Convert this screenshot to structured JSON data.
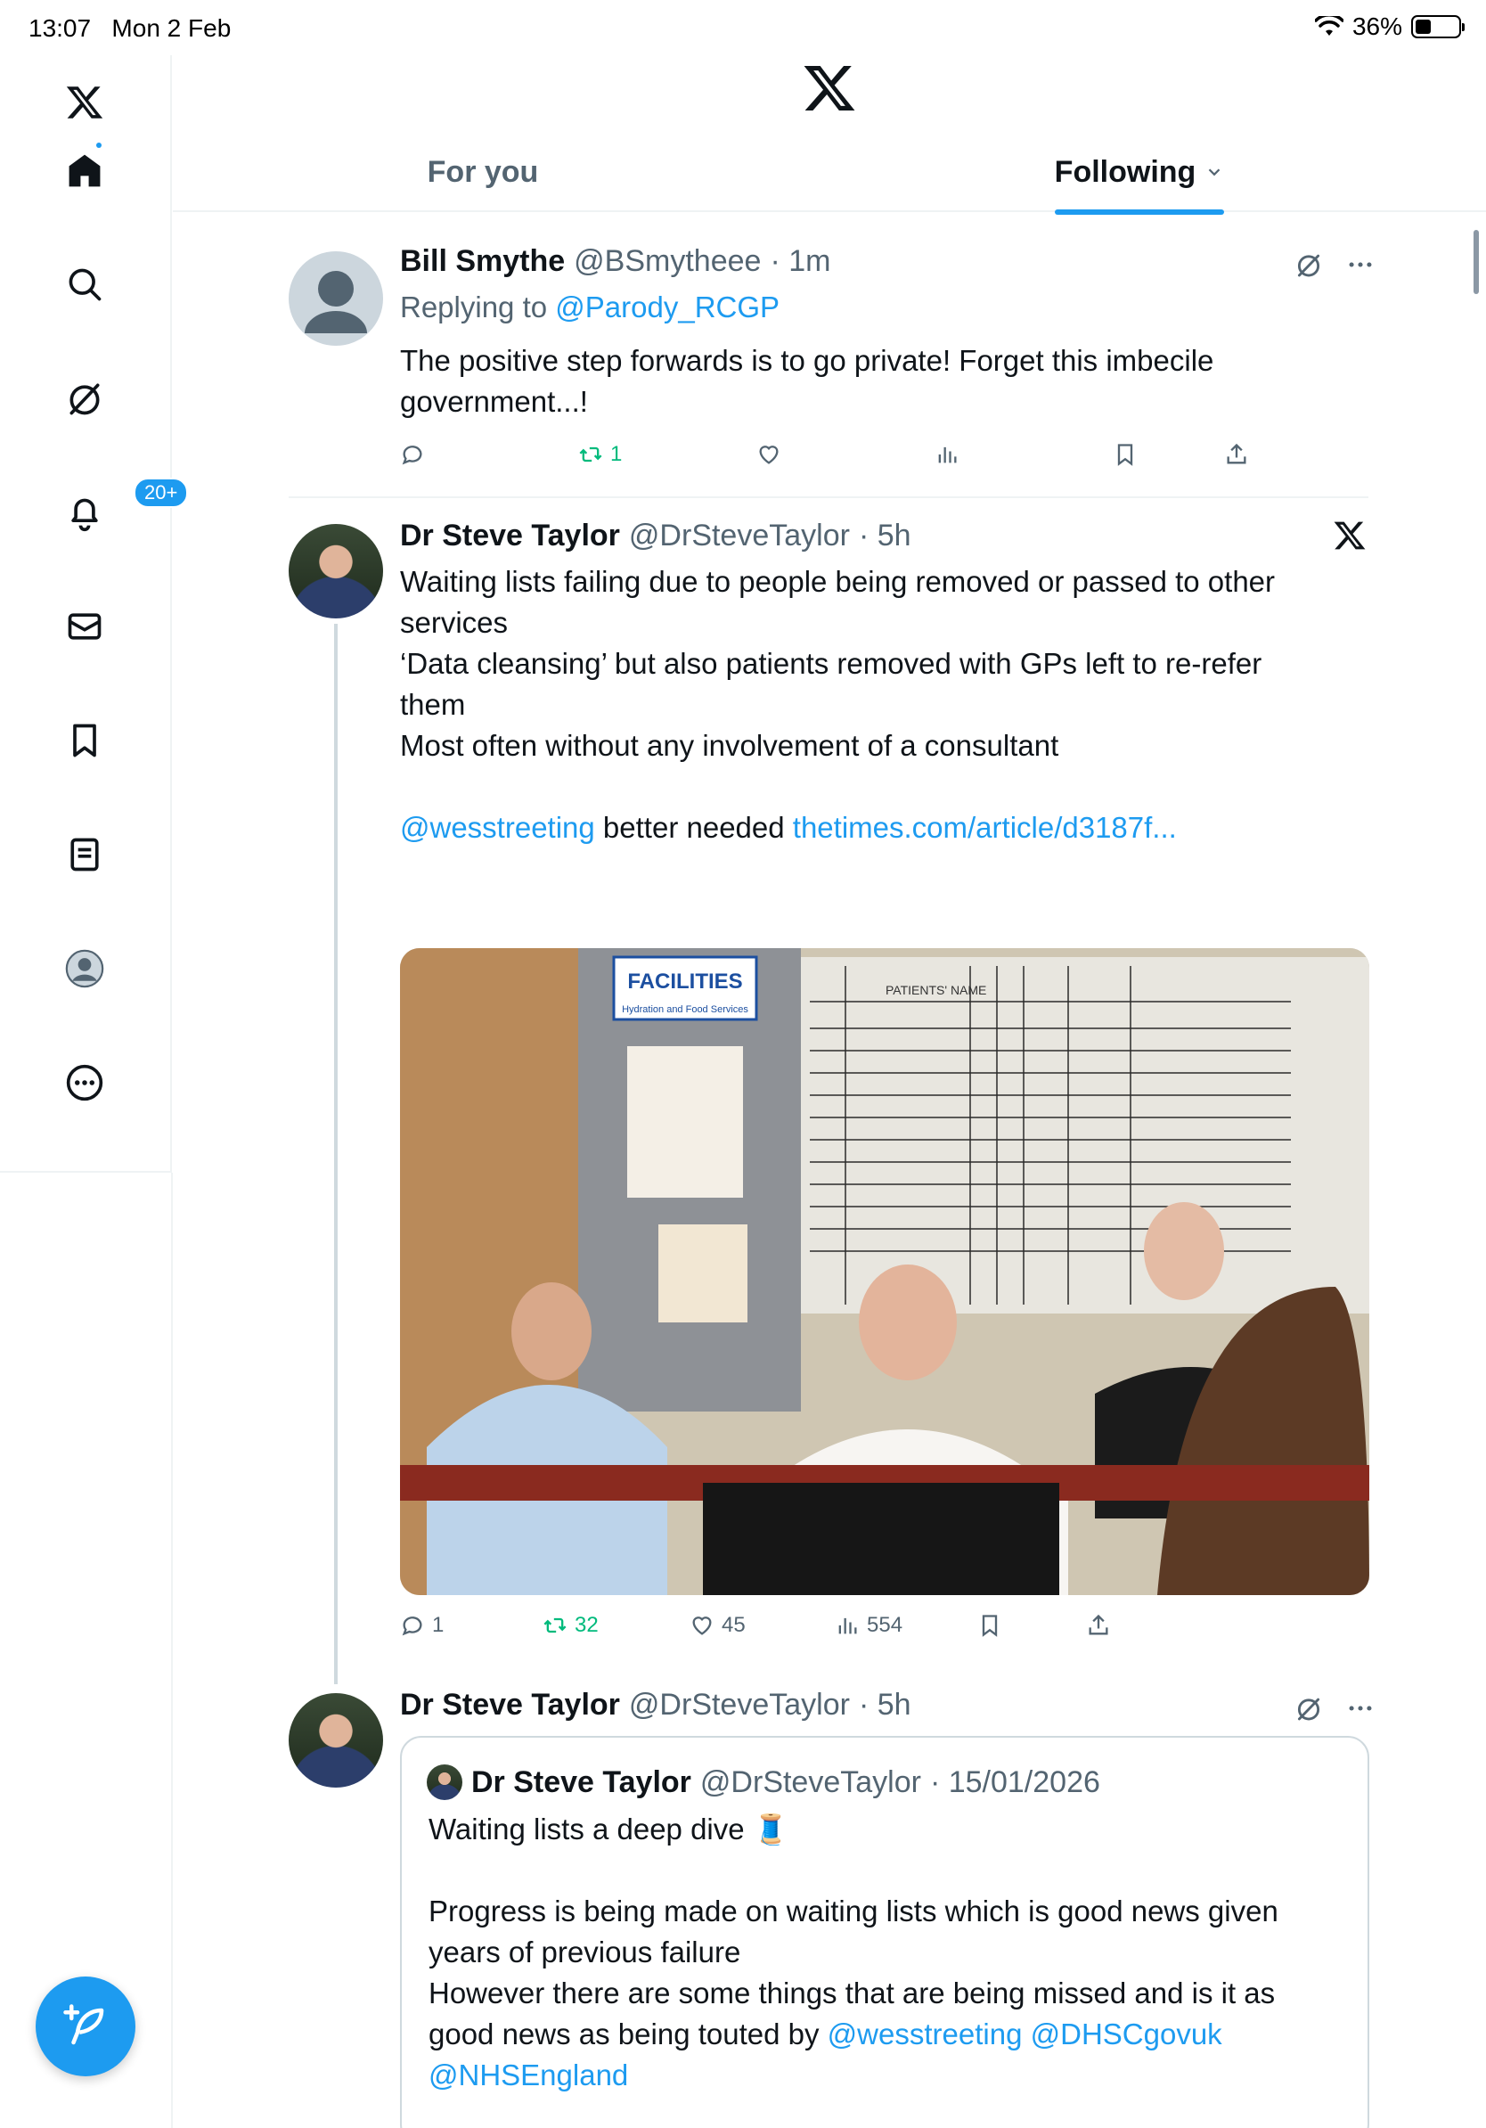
{
  "status_bar": {
    "time": "13:07",
    "date": "Mon 2 Feb",
    "battery": "36%",
    "battery_level": 0.36
  },
  "sidebar": {
    "notifications_badge": "20+",
    "items": [
      "home-icon",
      "search-icon",
      "grok-icon",
      "bell-icon",
      "mail-icon",
      "bookmark-icon",
      "lists-icon",
      "profile-icon",
      "more-icon"
    ]
  },
  "tabs": {
    "for_you": "For you",
    "following": "Following"
  },
  "posts": [
    {
      "name": "Bill Smythe",
      "handle": "@BSmytheee",
      "time": "· 1m",
      "replying_to_prefix": "Replying to",
      "replying_to_handle": "@Parody_RCGP",
      "text": "The positive step forwards is to go private! Forget this imbecile government...!",
      "retweets": "1"
    },
    {
      "name": "Dr Steve Taylor",
      "handle": "@DrSteveTaylor",
      "time": "· 5h",
      "para1": "Waiting lists failing due to people being removed or passed to other services",
      "para2": "‘Data cleansing’ but also patients removed with GPs left to re-refer them",
      "para3": "Most often without any involvement of a consultant",
      "mention": "@wesstreeting",
      "mid_text": " better needed ",
      "link": "thetimes.com/article/d3187f...",
      "replies": "1",
      "retweets": "32",
      "likes": "45",
      "views": "554",
      "image_text": {
        "sign": "FACILITIES",
        "sign_sub": "Hydration and Food Services",
        "board_header": "PATIENTS' NAME"
      }
    },
    {
      "name": "Dr Steve Taylor",
      "handle": "@DrSteveTaylor",
      "time": "· 5h",
      "quote": {
        "name": "Dr Steve Taylor",
        "handle": "@DrSteveTaylor",
        "time": "· 15/01/2026",
        "para1": "Waiting lists a deep dive 🧵",
        "para2": "Progress is being made on waiting lists which is good news given years of previous failure",
        "para3": "However there are some things that are being missed and is it as good news as being touted by",
        "mention1": "@wesstreeting",
        "mention2": "@DHSCgovuk",
        "mention3": "@NHSEngland"
      }
    }
  ],
  "colors": {
    "accent": "#1d9bf0",
    "retweet_green": "#00ba7c",
    "muted": "#536471",
    "text": "#0f1419"
  }
}
